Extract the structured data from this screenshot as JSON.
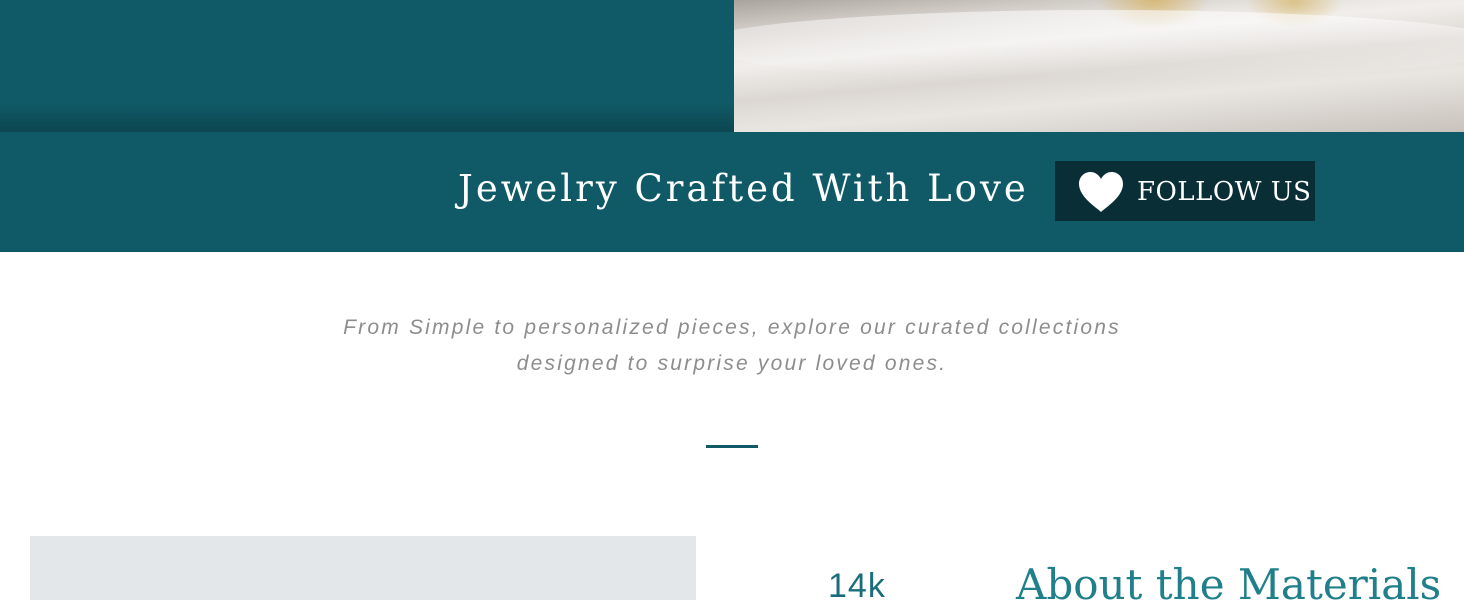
{
  "banner": {
    "title": "Jewelry Crafted With Love",
    "follow_label": "FOLLOW US",
    "icon": "heart-icon"
  },
  "tagline": {
    "line1": "From Simple to personalized pieces, explore our curated collections",
    "line2": "designed to surprise your loved ones."
  },
  "materials": {
    "karat_label": "14k",
    "heading": "About the Materials"
  },
  "colors": {
    "teal": "#0f5a66",
    "dark_teal": "#0a2e35",
    "accent_teal": "#1f7f8a",
    "tagline_gray": "#8d8d8d",
    "panel_gray": "#e4e7ea"
  }
}
